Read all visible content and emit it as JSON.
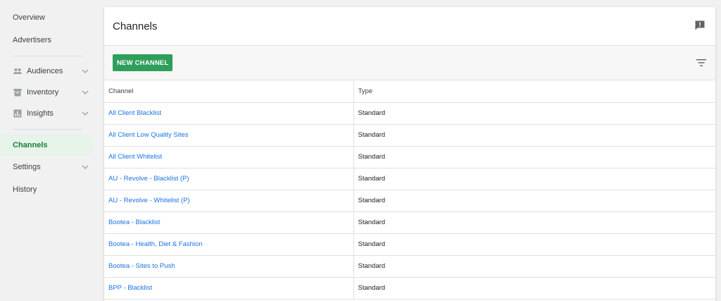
{
  "sidebar": {
    "overview": "Overview",
    "advertisers": "Advertisers",
    "audiences": "Audiences",
    "inventory": "Inventory",
    "insights": "Insights",
    "channels": "Channels",
    "settings": "Settings",
    "history": "History"
  },
  "page": {
    "title": "Channels",
    "new_button": "NEW CHANNEL"
  },
  "table": {
    "headers": {
      "channel": "Channel",
      "type": "Type"
    },
    "rows": [
      {
        "channel": "All Client Blacklist",
        "type": "Standard"
      },
      {
        "channel": "All Client Low Quality Sites",
        "type": "Standard"
      },
      {
        "channel": "All Client Whitelist",
        "type": "Standard"
      },
      {
        "channel": "AU - Revolve - Blacklist (P)",
        "type": "Standard"
      },
      {
        "channel": "AU - Revolve - Whitelist (P)",
        "type": "Standard"
      },
      {
        "channel": "Bootea - Blacklist",
        "type": "Standard"
      },
      {
        "channel": "Bootea - Health, Diet & Fashion",
        "type": "Standard"
      },
      {
        "channel": "Bootea - Sites to Push",
        "type": "Standard"
      },
      {
        "channel": "BPP - Blacklist",
        "type": "Standard"
      }
    ]
  },
  "colors": {
    "accent_green": "#2e9e5b",
    "active_nav_bg": "#e6f4ea",
    "link_blue": "#1a73e8"
  },
  "icons": {
    "audiences": "people-icon",
    "inventory": "inventory-box-icon",
    "insights": "bar-chart-icon",
    "feedback": "feedback-icon",
    "filter": "filter-icon",
    "expand": "chevron-down-icon"
  }
}
